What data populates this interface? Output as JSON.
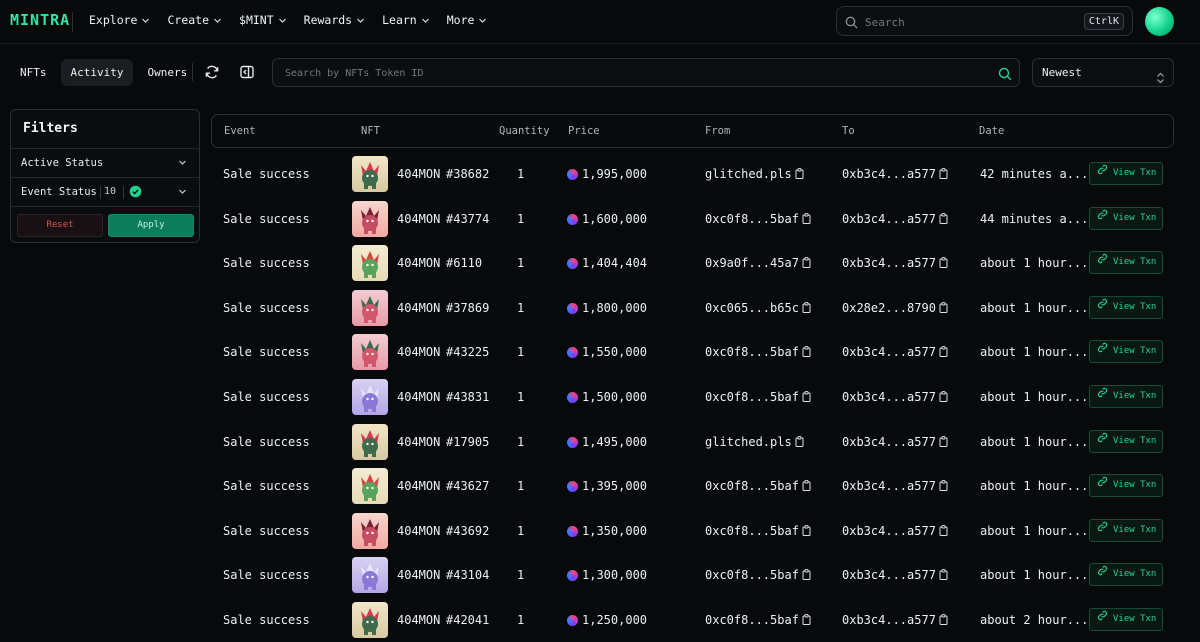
{
  "brand": {
    "logo": "MINTRA",
    "accent": "#2ee6a6"
  },
  "nav": {
    "items": [
      {
        "label": "Explore"
      },
      {
        "label": "Create"
      },
      {
        "label": "$MINT"
      },
      {
        "label": "Rewards"
      },
      {
        "label": "Learn"
      },
      {
        "label": "More"
      }
    ],
    "search_placeholder": "Search",
    "search_shortcut": "CtrlK"
  },
  "toolbar": {
    "tabs": [
      {
        "label": "NFTs",
        "active": false
      },
      {
        "label": "Activity",
        "active": true
      },
      {
        "label": "Owners",
        "active": false
      }
    ],
    "refresh_icon": "refresh-icon",
    "collapse_icon": "sidebar-collapse-icon",
    "token_search_placeholder": "Search by NFTs Token ID",
    "sort_value": "Newest"
  },
  "filters": {
    "title": "Filters",
    "active_status_label": "Active Status",
    "event_status_label": "Event Status",
    "event_status_count": "10",
    "reset_label": "Reset",
    "apply_label": "Apply"
  },
  "table": {
    "columns": [
      "Event",
      "NFT",
      "Quantity",
      "Price",
      "From",
      "To",
      "Date"
    ],
    "action_label": "View Txn",
    "rows": [
      {
        "event": "Sale success",
        "collection": "404MON",
        "token": "#38682",
        "qty": "1",
        "price": "1,995,000",
        "from": "glitched.pls",
        "to": "0xb3c4...a577",
        "date": "42 minutes a...",
        "art": "green"
      },
      {
        "event": "Sale success",
        "collection": "404MON",
        "token": "#43774",
        "qty": "1",
        "price": "1,600,000",
        "from": "0xc0f8...5baf",
        "to": "0xb3c4...a577",
        "date": "44 minutes a...",
        "art": "pink"
      },
      {
        "event": "Sale success",
        "collection": "404MON",
        "token": "#6110",
        "qty": "1",
        "price": "1,404,404",
        "from": "0x9a0f...45a7",
        "to": "0xb3c4...a577",
        "date": "about 1 hour...",
        "art": "bird"
      },
      {
        "event": "Sale success",
        "collection": "404MON",
        "token": "#37869",
        "qty": "1",
        "price": "1,800,000",
        "from": "0xc065...b65c",
        "to": "0x28e2...8790",
        "date": "about 1 hour...",
        "art": "rose"
      },
      {
        "event": "Sale success",
        "collection": "404MON",
        "token": "#43225",
        "qty": "1",
        "price": "1,550,000",
        "from": "0xc0f8...5baf",
        "to": "0xb3c4...a577",
        "date": "about 1 hour...",
        "art": "rose"
      },
      {
        "event": "Sale success",
        "collection": "404MON",
        "token": "#43831",
        "qty": "1",
        "price": "1,500,000",
        "from": "0xc0f8...5baf",
        "to": "0xb3c4...a577",
        "date": "about 1 hour...",
        "art": "purple"
      },
      {
        "event": "Sale success",
        "collection": "404MON",
        "token": "#17905",
        "qty": "1",
        "price": "1,495,000",
        "from": "glitched.pls",
        "to": "0xb3c4...a577",
        "date": "about 1 hour...",
        "art": "green"
      },
      {
        "event": "Sale success",
        "collection": "404MON",
        "token": "#43627",
        "qty": "1",
        "price": "1,395,000",
        "from": "0xc0f8...5baf",
        "to": "0xb3c4...a577",
        "date": "about 1 hour...",
        "art": "bird"
      },
      {
        "event": "Sale success",
        "collection": "404MON",
        "token": "#43692",
        "qty": "1",
        "price": "1,350,000",
        "from": "0xc0f8...5baf",
        "to": "0xb3c4...a577",
        "date": "about 1 hour...",
        "art": "pink"
      },
      {
        "event": "Sale success",
        "collection": "404MON",
        "token": "#43104",
        "qty": "1",
        "price": "1,300,000",
        "from": "0xc0f8...5baf",
        "to": "0xb3c4...a577",
        "date": "about 1 hour...",
        "art": "purple"
      },
      {
        "event": "Sale success",
        "collection": "404MON",
        "token": "#42041",
        "qty": "1",
        "price": "1,250,000",
        "from": "0xc0f8...5baf",
        "to": "0xb3c4...a577",
        "date": "about 2 hour...",
        "art": "green"
      }
    ]
  },
  "colors": {
    "background": "#07090b",
    "border": "#2a3036",
    "accent_green": "#20d494",
    "reset_red": "#e0534f"
  }
}
